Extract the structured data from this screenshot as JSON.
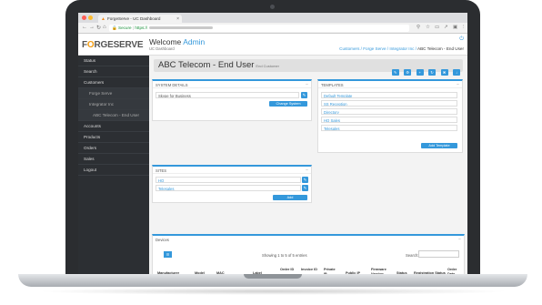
{
  "browser": {
    "tab_title": "ForgeServe - UC Dashboard",
    "secure_label": "Secure",
    "url_prefix": "https://"
  },
  "header": {
    "logo_a": "F",
    "logo_o": "O",
    "logo_b": "RGESERVE",
    "welcome": "Welcome",
    "user": "Admin",
    "subtitle": "UC Dashboard",
    "breadcrumbs": [
      "Customers",
      "Forge Serve",
      "Integrator Inc"
    ],
    "breadcrumb_current": "ABC Telecom - End User"
  },
  "sidebar": {
    "items": [
      {
        "label": "Status"
      },
      {
        "label": "Search"
      },
      {
        "label": "Customers"
      },
      {
        "label": "Forge Serve"
      },
      {
        "label": "Integrator Inc"
      },
      {
        "label": "ABC Telecom - End User"
      },
      {
        "label": "Accounts"
      },
      {
        "label": "Products"
      },
      {
        "label": "Orders"
      },
      {
        "label": "Sales"
      },
      {
        "label": "Logout"
      }
    ]
  },
  "page": {
    "title": "ABC Telecom - End User",
    "subtitle": "End Customer"
  },
  "system_details": {
    "header": "System Details",
    "system_value": "Skype for Business",
    "button": "Change System"
  },
  "templates": {
    "header": "Templates",
    "items": [
      "Default Template",
      "SS Reception",
      "Directory",
      "HQ Sales",
      "Telesales"
    ],
    "button": "Add Template"
  },
  "sites": {
    "header": "Sites",
    "items": [
      "HQ",
      "Telesales"
    ],
    "button": "Add"
  },
  "devices": {
    "header": "Devices",
    "showing": "Showing 1 to 5 of 5 entries",
    "search_label": "Search:",
    "columns": [
      "Manufacturer",
      "Model",
      "MAC",
      "Label",
      "Order ID",
      "Invoice ID",
      "Private IP",
      "Public IP",
      "Firmware Version",
      "Status",
      "Registration Status",
      "Order Date"
    ]
  },
  "colors": {
    "accent": "#3498db",
    "sidebar": "#2c2f33",
    "logo_o": "#f39c12"
  }
}
